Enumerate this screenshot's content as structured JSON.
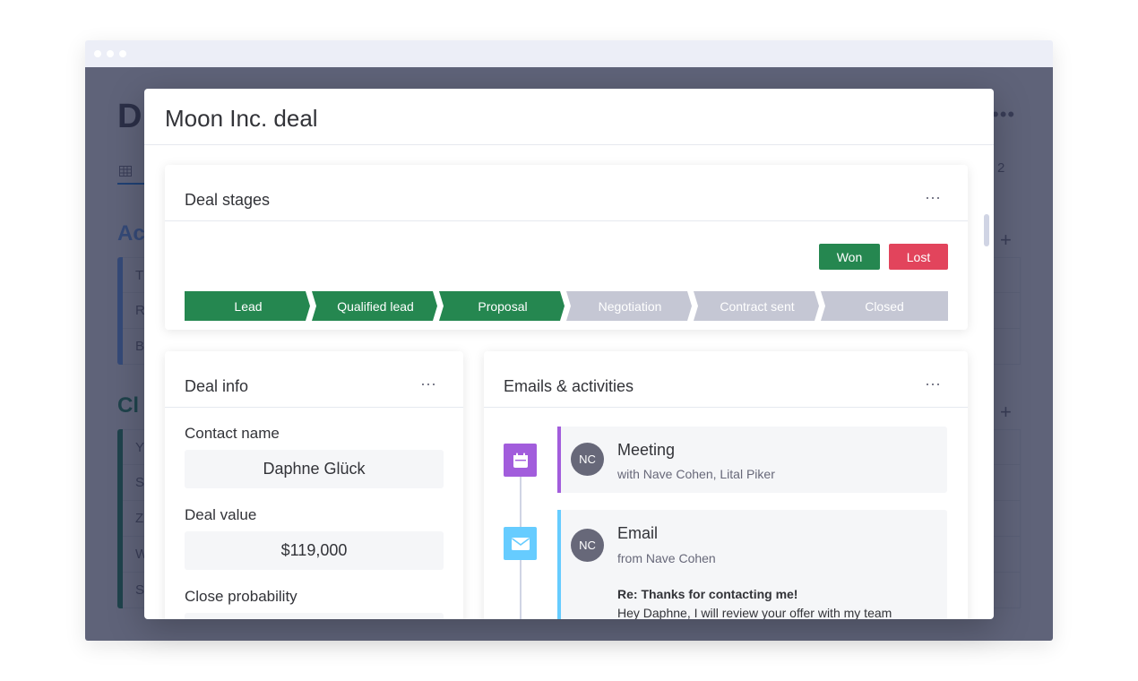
{
  "background_app": {
    "title": "D",
    "group1_title": "Ac",
    "group1_rows": [
      "T",
      "R",
      "B"
    ],
    "group2_title": "Cl",
    "group2_rows": [
      "Y",
      "S",
      "Z",
      "W",
      "S"
    ],
    "count": "2",
    "more": "•••",
    "plus": "+"
  },
  "modal": {
    "title": "Moon Inc. deal"
  },
  "deal_stages": {
    "title": "Deal stages",
    "more": "···",
    "won_label": "Won",
    "lost_label": "Lost",
    "stages": [
      {
        "label": "Lead",
        "state": "done"
      },
      {
        "label": "Qualified lead",
        "state": "done"
      },
      {
        "label": "Proposal",
        "state": "done"
      },
      {
        "label": "Negotiation",
        "state": "pending"
      },
      {
        "label": "Contract sent",
        "state": "pending"
      },
      {
        "label": "Closed",
        "state": "pending"
      }
    ]
  },
  "deal_info": {
    "title": "Deal info",
    "more": "···",
    "contact_label": "Contact name",
    "contact_value": "Daphne Glück",
    "value_label": "Deal value",
    "value_value": "$119,000",
    "probability_label": "Close probability"
  },
  "activities": {
    "title": "Emails & activities",
    "more": "···",
    "items": [
      {
        "type": "Meeting",
        "icon": "calendar-icon",
        "avatar": "NC",
        "subtitle": "with Nave Cohen, Lital Piker"
      },
      {
        "type": "Email",
        "icon": "envelope-icon",
        "avatar": "NC",
        "subtitle": "from Nave Cohen",
        "subject": "Re: Thanks for contacting me!",
        "body": "Hey Daphne, I will review your offer with my team"
      }
    ]
  },
  "colors": {
    "done": "#258750",
    "pending": "#c5c7d4",
    "won": "#258750",
    "lost": "#e2445c",
    "meeting": "#a25ddc",
    "email": "#66ccff"
  }
}
